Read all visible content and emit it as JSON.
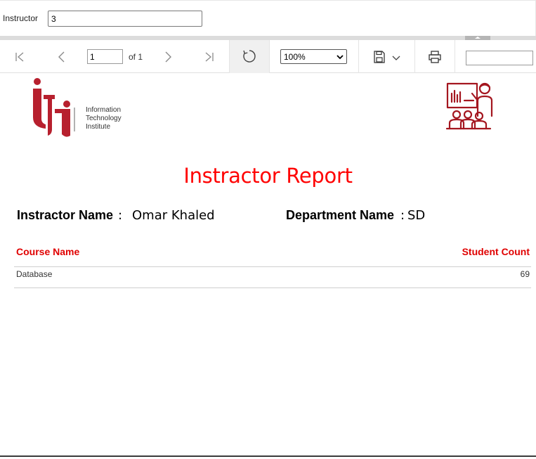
{
  "parameters": {
    "instructor_label": "Instructor",
    "instructor_value": "3"
  },
  "toolbar": {
    "current_page": "1",
    "of_pages": "of 1",
    "zoom": "100%",
    "search_value": ""
  },
  "report": {
    "logo_text": [
      "Information",
      "Technology",
      "Institute"
    ],
    "title": "Instractor Report",
    "instructor_label": "Instractor Name",
    "instructor_colon": ":",
    "instructor_value": "Omar Khaled",
    "department_label": "Department Name",
    "department_colon": ":",
    "department_value": "SD",
    "table": {
      "headers": [
        "Course Name",
        "Student Count"
      ],
      "rows": [
        {
          "course": "Database",
          "count": "69"
        }
      ]
    }
  },
  "colors": {
    "accent_red": "#ff0000",
    "brand_red": "#b7202e"
  }
}
